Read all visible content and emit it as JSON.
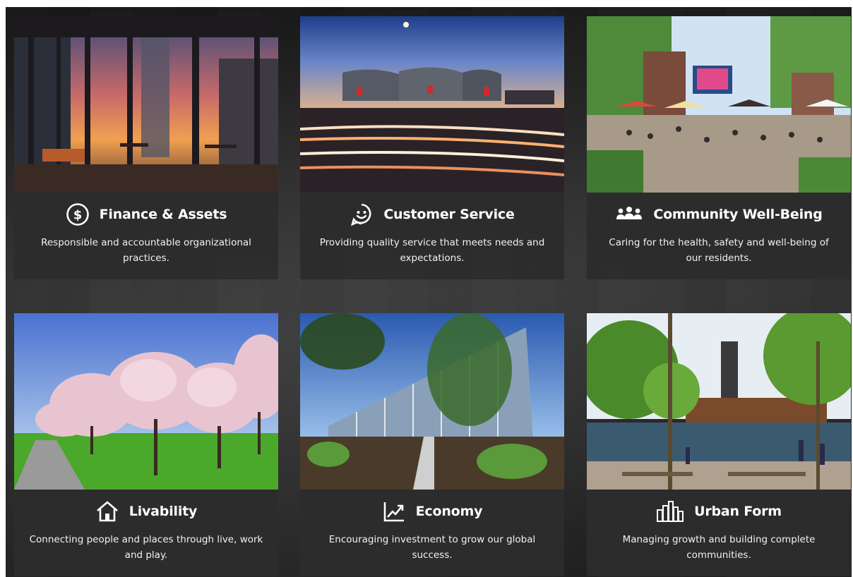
{
  "cards": [
    {
      "title": "Finance & Assets",
      "description": "Responsible and accountable organizational practices.",
      "icon": "dollar-circle-icon"
    },
    {
      "title": "Customer Service",
      "description": "Providing quality service that meets needs and expectations.",
      "icon": "smiley-chat-icon"
    },
    {
      "title": "Community Well-Being",
      "description": "Caring for the health, safety and well-being of our residents.",
      "icon": "people-group-icon"
    },
    {
      "title": "Livability",
      "description": "Connecting people and places through live, work and play.",
      "icon": "house-icon"
    },
    {
      "title": "Economy",
      "description": "Encouraging investment to grow our global success.",
      "icon": "trend-chart-icon"
    },
    {
      "title": "Urban Form",
      "description": "Managing growth and building complete communities.",
      "icon": "city-buildings-icon"
    }
  ],
  "colors": {
    "caption_bg": "#2d2d2d",
    "text": "#ffffff"
  }
}
